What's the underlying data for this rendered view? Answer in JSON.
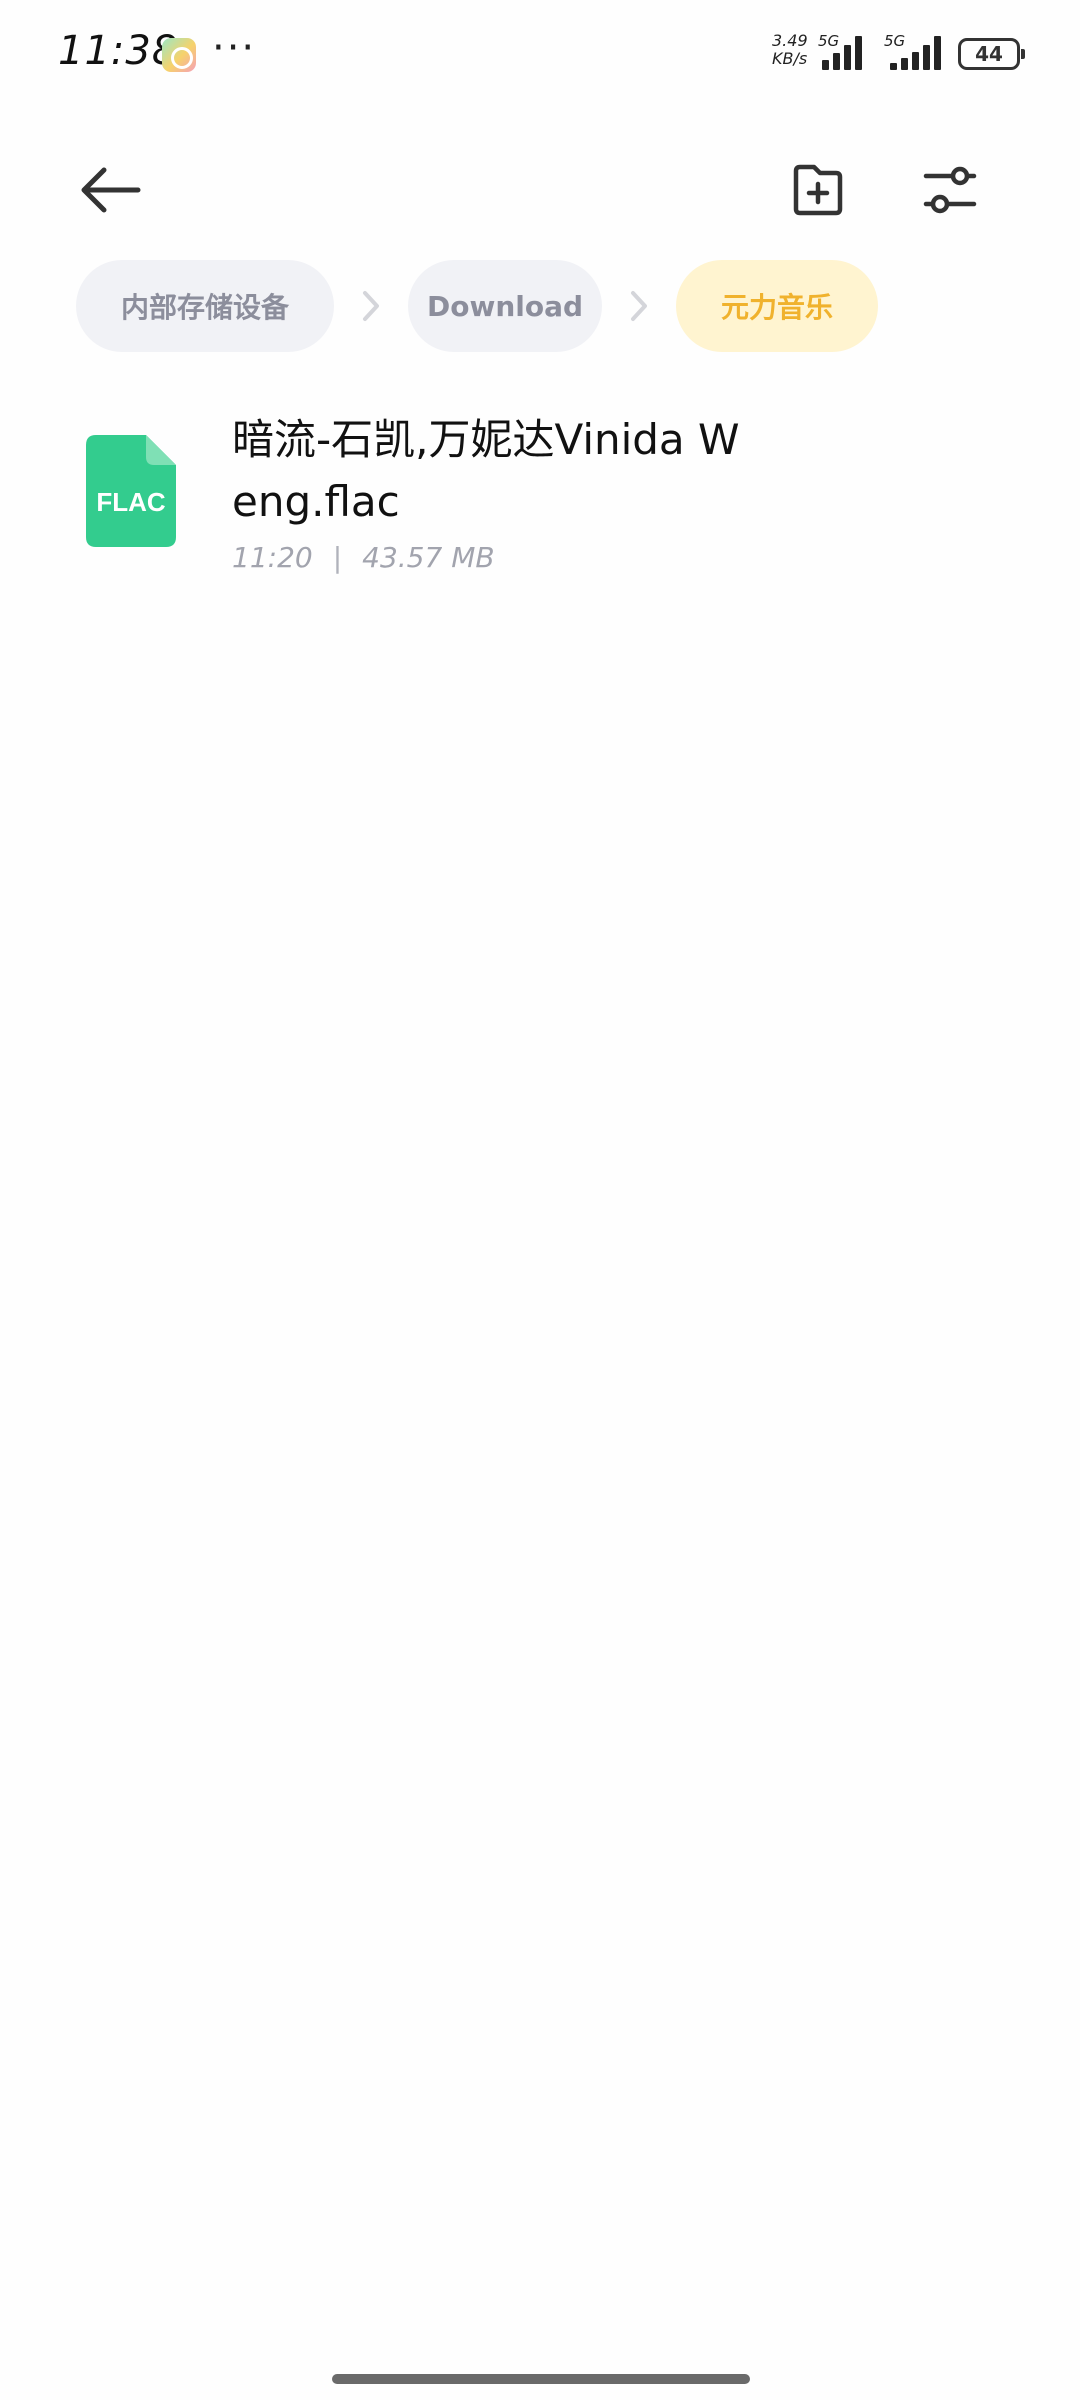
{
  "status_bar": {
    "time": "11:38",
    "more": "···",
    "network_speed_value": "3.49",
    "network_speed_unit": "KB/s",
    "sim1_type": "5G",
    "sim2_type": "5G",
    "battery_level": "44",
    "app_icon": "gallery-app-icon",
    "text_color": "#111111"
  },
  "toolbar": {
    "back_icon": "arrow-left-icon",
    "new_folder_icon": "folder-plus-icon",
    "filter_icon": "sliders-icon",
    "icon_color": "#333333"
  },
  "breadcrumb": {
    "items": [
      {
        "label": "内部存储设备",
        "active": false
      },
      {
        "label": "Download",
        "active": false
      },
      {
        "label": "元力音乐",
        "active": true
      }
    ],
    "separator_icon": "chevron-right-icon",
    "inactive_bg": "#f1f2f6",
    "inactive_text": "#8c8e9c",
    "active_bg": "#fff4d0",
    "active_text": "#f0b22d"
  },
  "files": [
    {
      "name": "暗流-石凯,万妮达Vinida Weng.flac",
      "type_label": "FLAC",
      "time": "11:20",
      "meta_separator": "|",
      "size": "43.57 MB",
      "icon": "flac-file-icon",
      "icon_color": "#33cc8e"
    }
  ]
}
